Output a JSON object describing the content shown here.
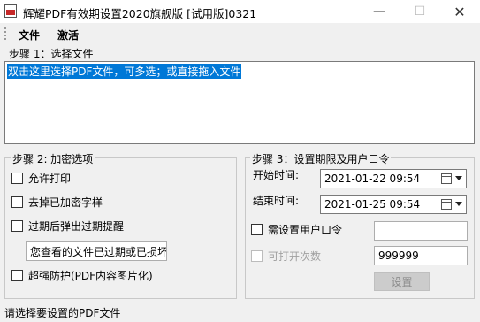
{
  "window": {
    "title": "辉耀PDF有效期设置2020旗舰版 [试用版]0321",
    "minimize": "—",
    "maximize": "☐",
    "close": "✕"
  },
  "menu": {
    "items": [
      "文件",
      "激活"
    ]
  },
  "step1": {
    "label": "步骤 1：选择文件",
    "drop_text": "双击这里选择PDF文件，可多选；或直接拖入文件"
  },
  "step2": {
    "title": "步骤 2:  加密选项",
    "allow_print": "允许打印",
    "remove_encrypt": "去掉已加密字样",
    "popup_expired": "过期后弹出过期提醒",
    "expired_message": "您查看的文件已过期或已损坏",
    "protection": "超强防护(PDF内容图片化)"
  },
  "step3": {
    "title": "步骤 3：设置期限及用户口令",
    "start_label": "开始时间:",
    "start_value": "2021-01-22 09:54",
    "end_label": "结束时间:",
    "end_value": "2021-01-25 09:54",
    "need_password": "需设置用户口令",
    "password_value": "",
    "open_count_label": "可打开次数",
    "open_count_value": "999999",
    "set_button": "设置"
  },
  "status": {
    "text": "请选择要设置的PDF文件"
  }
}
